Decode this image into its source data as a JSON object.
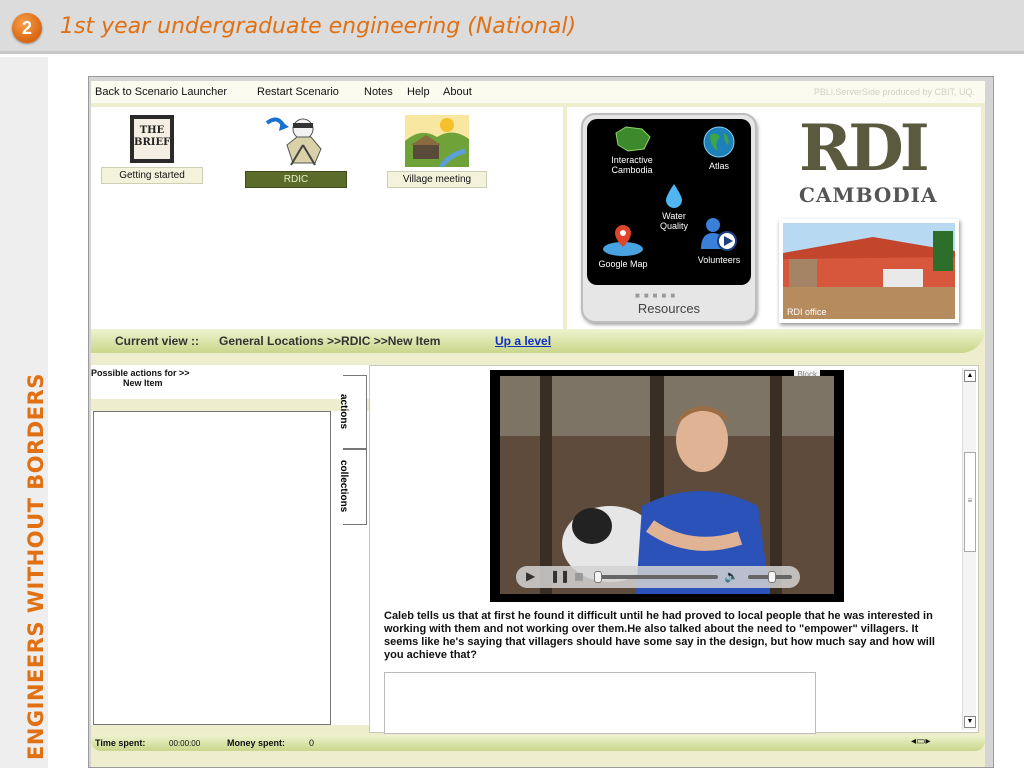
{
  "slide": {
    "number": "2",
    "title": "1st year  undergraduate engineering (National)",
    "side_label": "ENGINEERS WITHOUT BORDERS"
  },
  "menu": {
    "back": "Back to Scenario Launcher",
    "restart": "Restart Scenario",
    "notes": "Notes",
    "help": "Help",
    "about": "About",
    "credit": "PBLi.ServerSide produced by CBIT, UQ."
  },
  "nav_icons": {
    "brief_label": "Getting started",
    "brief_icon_text_1": "THE",
    "brief_icon_text_2": "BRIEF",
    "rdic_label": "RDIC",
    "village_label": "Village meeting"
  },
  "resources": {
    "title": "Resources",
    "items": [
      "Interactive Cambodia",
      "Atlas",
      "Water Quality",
      "Google Map",
      "Volunteers"
    ]
  },
  "rdi": {
    "logo_letters": "RDI",
    "logo_country": "CAMBODIA",
    "photo_caption": "RDI office"
  },
  "breadcrumb": {
    "prefix": "Current view ::",
    "path": "General Locations  >>RDIC  >>New Item",
    "up_link": "Up a level"
  },
  "actions": {
    "header_line1": "Possible actions for >>",
    "header_line2": "New Item",
    "tab_actions": "actions",
    "tab_collections": "collections"
  },
  "content": {
    "video_block_label": "Block",
    "description": "Caleb tells us that at first he found it difficult until he had proved to local people that he was interested in working with them and not working over them.He also talked about the need to \"empower\" villagers. It seems like he's saying that villagers should have some say in the design, but how much say and how will you achieve that?",
    "video_progress": 0.0,
    "video_volume": 0.55
  },
  "status": {
    "time_label": "Time spent:",
    "time_value": "00:00:00",
    "money_label": "Money spent:",
    "money_value": "0"
  }
}
